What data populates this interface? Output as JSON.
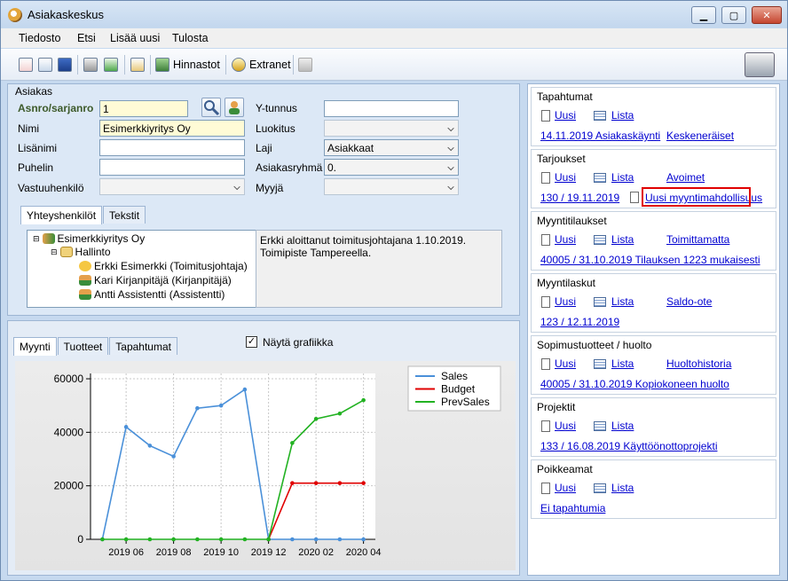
{
  "window": {
    "title": "Asiakaskeskus"
  },
  "menu": [
    "Tiedosto",
    "Etsi",
    "Lisää uusi",
    "Tulosta"
  ],
  "toolbar": {
    "hinnastot": "Hinnastot",
    "extranet": "Extranet"
  },
  "customer": {
    "group_title": "Asiakas",
    "asnro_label": "Asnro/sarjanro",
    "asnro_value": "1",
    "nimi_label": "Nimi",
    "nimi_value": "Esimerkkiyritys Oy",
    "lisanimi_label": "Lisänimi",
    "lisanimi_value": "",
    "puhelin_label": "Puhelin",
    "puhelin_value": "",
    "vastuuhenkilo_label": "Vastuuhenkilö",
    "vastuuhenkilo_value": "",
    "ytunnus_label": "Y-tunnus",
    "ytunnus_value": "",
    "luokitus_label": "Luokitus",
    "luokitus_value": "",
    "laji_label": "Laji",
    "laji_value": "Asiakkaat",
    "asiakasryhma_label": "Asiakasryhmä",
    "asiakasryhma_value": "0.",
    "myyja_label": "Myyjä",
    "myyja_value": ""
  },
  "contact_tabs": [
    "Yhteyshenkilöt",
    "Tekstit"
  ],
  "tree": [
    "Esimerkkiyritys Oy",
    "Hallinto",
    "Erkki Esimerkki (Toimitusjohtaja)",
    "Kari Kirjanpitäjä (Kirjanpitäjä)",
    "Antti Assistentti (Assistentti)"
  ],
  "memo": "Erkki aloittanut toimitusjohtajana 1.10.2019. Toimipiste Tampereella.",
  "bottom_tabs": [
    "Myynti",
    "Tuotteet",
    "Tapahtumat"
  ],
  "show_chart_label": "Näytä grafiikka",
  "show_chart_checked": true,
  "chart_data": {
    "type": "line",
    "x": [
      "2019 05",
      "2019 06",
      "2019 07",
      "2019 08",
      "2019 09",
      "2019 10",
      "2019 11",
      "2019 12",
      "2020 01",
      "2020 02",
      "2020 03",
      "2020 04"
    ],
    "xticks": [
      "2019 06",
      "2019 08",
      "2019 10",
      "2019 12",
      "2020 02",
      "2020 04"
    ],
    "yticks": [
      "0",
      "20000",
      "40000",
      "60000"
    ],
    "ylim": [
      0,
      62000
    ],
    "grid": true,
    "legend": "top-right",
    "series": [
      {
        "name": "Sales",
        "color": "#4a90d9",
        "values": [
          0,
          42000,
          35000,
          31000,
          49000,
          50000,
          56000,
          0,
          0,
          0,
          0,
          0
        ]
      },
      {
        "name": "Budget",
        "color": "#e00000",
        "values": [
          null,
          null,
          null,
          null,
          null,
          null,
          null,
          0,
          21000,
          21000,
          21000,
          21000
        ]
      },
      {
        "name": "PrevSales",
        "color": "#22b222",
        "values": [
          0,
          0,
          0,
          0,
          0,
          0,
          0,
          0,
          36000,
          45000,
          47000,
          52000
        ]
      }
    ]
  },
  "sections": [
    {
      "title": "Tapahtumat",
      "uusi": "Uusi",
      "lista": "Lista",
      "links": [
        "14.11.2019 Asiakaskäynti",
        "Keskeneräiset"
      ]
    },
    {
      "title": "Tarjoukset",
      "uusi": "Uusi",
      "lista": "Lista",
      "links": [
        "Avoimet",
        "130 / 19.11.2019",
        "Uusi myyntimahdollisuus"
      ]
    },
    {
      "title": "Myyntitilaukset",
      "uusi": "Uusi",
      "lista": "Lista",
      "links": [
        "Toimittamatta",
        "40005 / 31.10.2019 Tilauksen 1223 mukaisesti"
      ]
    },
    {
      "title": "Myyntilaskut",
      "uusi": "Uusi",
      "lista": "Lista",
      "links": [
        "Saldo-ote",
        "123 / 12.11.2019"
      ]
    },
    {
      "title": "Sopimustuotteet / huolto",
      "uusi": "Uusi",
      "lista": "Lista",
      "links": [
        "Huoltohistoria",
        "40005 / 31.10.2019 Kopiokoneen huolto"
      ]
    },
    {
      "title": "Projektit",
      "uusi": "Uusi",
      "lista": "Lista",
      "links": [
        "133 / 16.08.2019 Käyttöönottoprojekti"
      ]
    },
    {
      "title": "Poikkeamat",
      "uusi": "Uusi",
      "lista": "Lista",
      "links": [
        "Ei tapahtumia"
      ]
    }
  ]
}
